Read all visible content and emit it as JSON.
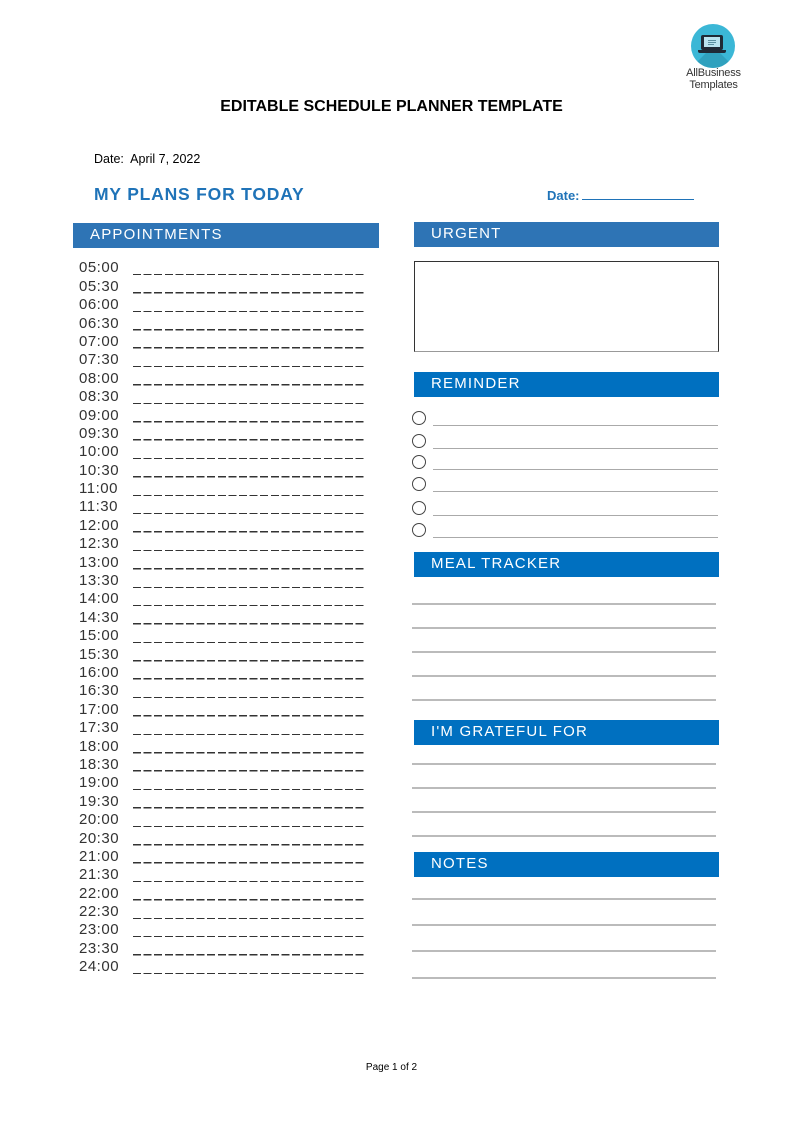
{
  "logo": {
    "brand_line1": "AllBusiness",
    "brand_line2": "Templates",
    "icon": "laptop-icon"
  },
  "document": {
    "title": "EDITABLE SCHEDULE PLANNER TEMPLATE",
    "date_label": "Date:",
    "date_value": "April 7, 2022",
    "plans_heading": "MY PLANS FOR TODAY",
    "plans_date_label": "Date:"
  },
  "appointments": {
    "header": "APPOINTMENTS",
    "times": [
      "05:00",
      "05:30",
      "06:00",
      "06:30",
      "07:00",
      "07:30",
      "08:00",
      "08:30",
      "09:00",
      "09:30",
      "10:00",
      "10:30",
      "11:00",
      "11:30",
      "12:00",
      "12:30",
      "13:00",
      "13:30",
      "14:00",
      "14:30",
      "15:00",
      "15:30",
      "16:00",
      "16:30",
      "17:00",
      "17:30",
      "18:00",
      "18:30",
      "19:00",
      "19:30",
      "20:00",
      "20:30",
      "21:00",
      "21:30",
      "22:00",
      "22:30",
      "23:00",
      "23:30",
      "24:00"
    ]
  },
  "urgent": {
    "header": "URGENT",
    "content": ""
  },
  "reminder": {
    "header": "REMINDER",
    "items": [
      "",
      "",
      "",
      "",
      "",
      ""
    ]
  },
  "meal_tracker": {
    "header": "MEAL TRACKER",
    "lines": [
      "",
      "",
      "",
      "",
      ""
    ]
  },
  "grateful": {
    "header": "I'M GRATEFUL FOR",
    "lines": [
      "",
      "",
      "",
      ""
    ]
  },
  "notes": {
    "header": "NOTES",
    "lines": [
      "",
      "",
      "",
      ""
    ]
  },
  "colors": {
    "header_blue_a": "#2e74b5",
    "header_blue_b": "#0070c0",
    "heading_blue": "#1f73b8"
  },
  "footer": {
    "page_label": "Page 1 of 2"
  }
}
